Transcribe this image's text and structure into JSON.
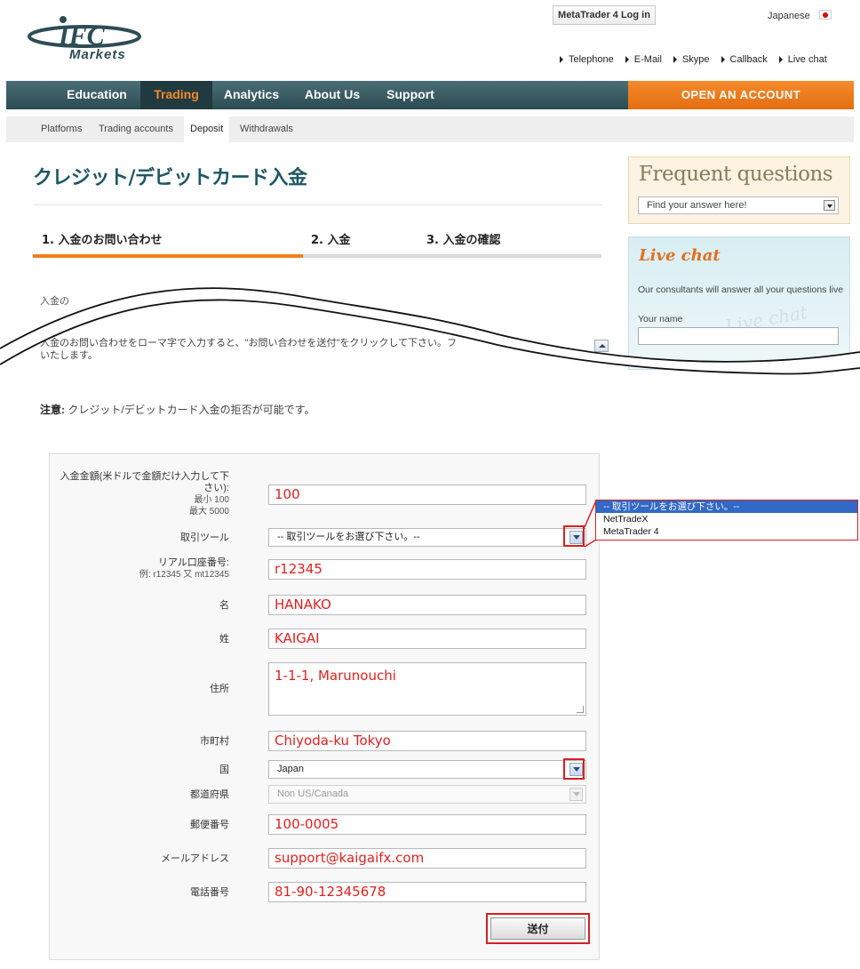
{
  "header": {
    "logo_text": "IFC",
    "logo_sub": "Markets",
    "mt4_login": "MetaTrader 4 Log in",
    "language": "Japanese",
    "contact_links": [
      "Telephone",
      "E-Mail",
      "Skype",
      "Callback",
      "Live chat"
    ]
  },
  "nav": {
    "items": [
      "Education",
      "Trading",
      "Analytics",
      "About Us",
      "Support"
    ],
    "active": "Trading",
    "open_account": "OPEN AN ACCOUNT"
  },
  "subnav": {
    "items": [
      "Platforms",
      "Trading accounts",
      "Deposit",
      "Withdrawals"
    ],
    "active": "Deposit"
  },
  "page": {
    "title": "クレジット/デビットカード入金",
    "steps": [
      "1. 入金のお問い合わせ",
      "2. 入金",
      "3. 入金の確認"
    ],
    "intro_fragment": "入金の",
    "intro_text": "入金のお問い合わせをローマ字で入力すると、\"お問い合わせを送付\"をクリックして下さい。フ いたします。",
    "notice_label": "注意:",
    "notice_text": "クレジット/デビットカード入金の拒否が可能です。"
  },
  "sidebar": {
    "faq_title": "Frequent questions",
    "faq_placeholder": "Find your answer here!",
    "livechat_title": "Live chat",
    "livechat_text": "Our consultants will answer all your questions live",
    "livechat_name_label": "Your name",
    "livechat_watermark": "Live chat"
  },
  "form": {
    "amount_label": "入金金額(米ドルで金額だけ入力して下さい):",
    "amount_min": "最小 100",
    "amount_max": "最大 5000",
    "amount_value": "100",
    "platform_label": "取引ツール",
    "platform_value": "-- 取引ツールをお選び下さい。--",
    "account_label": "リアル口座番号:",
    "account_example": "例: r12345 又 mt12345",
    "account_value": "r12345",
    "first_name_label": "名",
    "first_name_value": "HANAKO",
    "last_name_label": "姓",
    "last_name_value": "KAIGAI",
    "address_label": "住所",
    "address_value": "1-1-1, Marunouchi",
    "city_label": "市町村",
    "city_value": "Chiyoda-ku Tokyo",
    "country_label": "国",
    "country_value": "Japan",
    "state_label": "都道府県",
    "state_value": "Non US/Canada",
    "zip_label": "郵便番号",
    "zip_value": "100-0005",
    "email_label": "メールアドレス",
    "email_value": "support@kaigaifx.com",
    "phone_label": "電話番号",
    "phone_value": "81-90-12345678",
    "submit_label": "送付"
  },
  "platform_dropdown": {
    "options": [
      "-- 取引ツールをお選び下さい。--",
      "NetTradeX",
      "MetaTrader 4"
    ],
    "selected": "-- 取引ツールをお選び下さい。--"
  },
  "colors": {
    "nav_bg": "#2b4b52",
    "accent_orange": "#f07f1e",
    "title_teal": "#1f5864",
    "input_text_red": "#e02020",
    "highlight_red": "#d62020",
    "selected_option_blue": "#3169c6"
  }
}
